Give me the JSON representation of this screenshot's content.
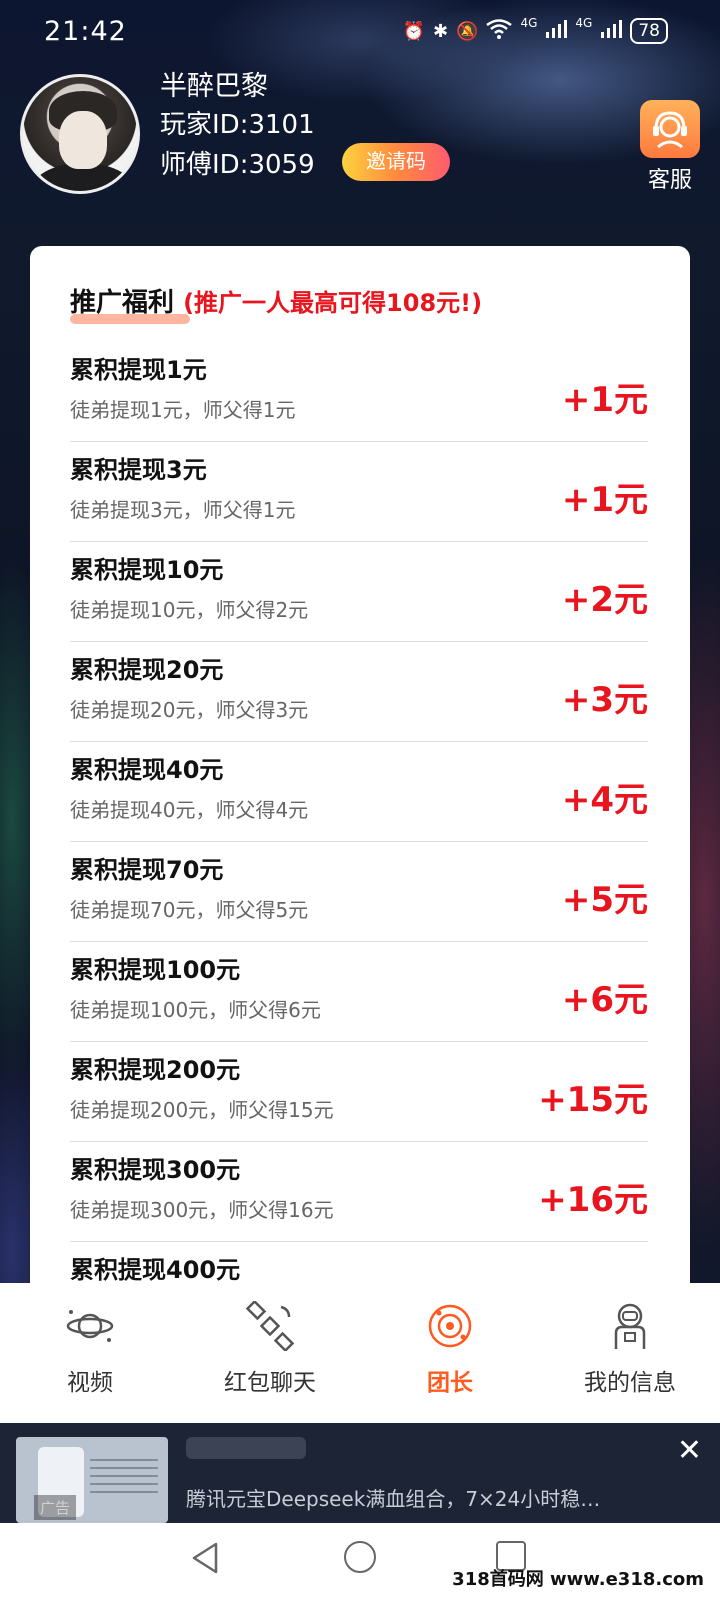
{
  "status_bar": {
    "time": "21:42",
    "network_1": "4G",
    "network_2": "4G",
    "battery": "78"
  },
  "profile": {
    "nickname": "半醉巴黎",
    "player_id": "玩家ID:3101",
    "master_id": "师傅ID:3059",
    "invite_button": "邀请码",
    "service_label": "客服"
  },
  "promo": {
    "title": "推广福利",
    "subtitle": "(推广一人最高可得108元!)",
    "rows": [
      {
        "title": "累积提现1元",
        "detail": "徒弟提现1元，师父得1元",
        "reward": "+1元"
      },
      {
        "title": "累积提现3元",
        "detail": "徒弟提现3元，师父得1元",
        "reward": "+1元"
      },
      {
        "title": "累积提现10元",
        "detail": "徒弟提现10元，师父得2元",
        "reward": "+2元"
      },
      {
        "title": "累积提现20元",
        "detail": "徒弟提现20元，师父得3元",
        "reward": "+3元"
      },
      {
        "title": "累积提现40元",
        "detail": "徒弟提现40元，师父得4元",
        "reward": "+4元"
      },
      {
        "title": "累积提现70元",
        "detail": "徒弟提现70元，师父得5元",
        "reward": "+5元"
      },
      {
        "title": "累积提现100元",
        "detail": "徒弟提现100元，师父得6元",
        "reward": "+6元"
      },
      {
        "title": "累积提现200元",
        "detail": "徒弟提现200元，师父得15元",
        "reward": "+15元"
      },
      {
        "title": "累积提现300元",
        "detail": "徒弟提现300元，师父得16元",
        "reward": "+16元"
      },
      {
        "title": "累积提现400元",
        "detail": "",
        "reward": ""
      }
    ]
  },
  "nav": {
    "items": [
      {
        "label": "视频",
        "icon": "planet-icon",
        "active": false
      },
      {
        "label": "红包聊天",
        "icon": "satellite-icon",
        "active": false
      },
      {
        "label": "团长",
        "icon": "galaxy-icon",
        "active": true
      },
      {
        "label": "我的信息",
        "icon": "astronaut-icon",
        "active": false
      }
    ]
  },
  "ad": {
    "tag": "广告",
    "text": "腾讯元宝Deepseek满血组合，7×24小时稳…",
    "close": "✕"
  },
  "watermark": "318首码网 www.e318.com",
  "colors": {
    "accent_red": "#e8141e",
    "active_orange": "#ff5a1f",
    "card_bg": "#ffffff"
  }
}
